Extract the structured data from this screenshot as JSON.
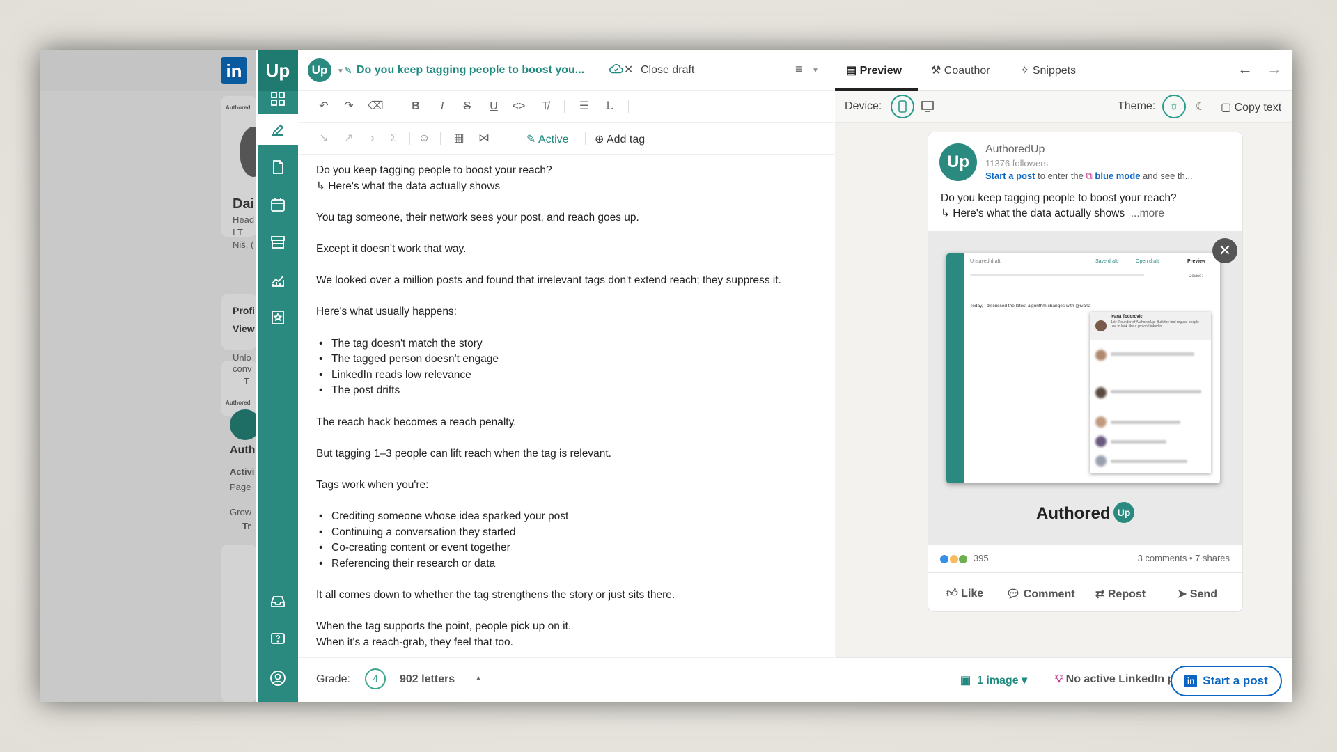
{
  "linkedin_bg": {
    "logo": "in",
    "authored_small": "Authored",
    "name_fragment": "Dai",
    "headline_fragment": "Head",
    "line2": "I T",
    "location_fragment": "Niš, (",
    "profile_fragment": "Profi",
    "view_fragment": "View",
    "unlock_fragment": "Unlo",
    "conv_fragment": "conv",
    "t_fragment": "T",
    "authored_small2": "Authored",
    "auth_fragment": "Auth",
    "activity_fragment": "Activi",
    "page_fragment": "Page",
    "grow_fragment": "Grow",
    "tr_fragment": "Tr"
  },
  "rail": {
    "logo": "Up",
    "items": [
      "dashboard-icon",
      "editor-icon",
      "drafts-icon",
      "calendar-icon",
      "archive-icon",
      "analytics-icon",
      "bookmark-icon",
      "inbox-icon",
      "help-icon",
      "profile-icon"
    ]
  },
  "editor": {
    "badge": "Up",
    "draft_title": "Do you keep tagging people to boost you...",
    "close_draft": "Close draft",
    "active_label": "Active",
    "add_tag_label": "Add tag",
    "body": [
      "Do you keep tagging people to boost your reach?",
      "↳ Here's what the data actually shows",
      "",
      "You tag someone, their network sees your post, and reach goes up.",
      "",
      "Except it doesn't work that way.",
      "",
      "We looked over a million posts and found that irrelevant tags don't extend reach; they suppress it.",
      "",
      "Here's what usually happens:",
      "",
      "•The tag doesn't match the story",
      "•The tagged person doesn't engage",
      "•LinkedIn reads low relevance",
      "•The post drifts",
      "",
      "The reach hack becomes a reach penalty.",
      "",
      "But tagging 1–3 people can lift reach when the tag is relevant.",
      "",
      "Tags work when you're:",
      "",
      "•Crediting someone whose idea sparked your post",
      "•Continuing a conversation they started",
      "•Co-creating content or event together",
      "•Referencing their research or data",
      "",
      "It all comes down to whether the tag strengthens the story or just sits there.",
      "",
      "When the tag supports the point, people pick up on it.",
      "When it's a reach-grab, they feel that too."
    ],
    "grade_label": "Grade:",
    "grade_value": "4",
    "letters": "902 letters"
  },
  "preview": {
    "tabs": [
      "Preview",
      "Coauthor",
      "Snippets"
    ],
    "device_label": "Device:",
    "theme_label": "Theme:",
    "copy_text": "Copy text",
    "post": {
      "author": "AuthoredUp",
      "followers": "11376 followers",
      "cta_link": "Start a post",
      "cta_mid": " to enter the ",
      "cta_mode": "blue mode",
      "cta_end": " and see th...",
      "line1": "Do you keep tagging people to boost your reach?",
      "line2": "↳ Here's what the data actually shows",
      "more": "...more",
      "image_brand": "Authored",
      "image_brand_up": "Up",
      "mini_unsaved": "Unsaved draft",
      "mini_save": "Save draft",
      "mini_open": "Open draft",
      "mini_preview": "Preview",
      "mini_device": "Device:",
      "mini_text": "Today, I discussed the latest algorithm changes with @ivana",
      "mini_person": "Ivana Todorovic",
      "mini_person_sub": "1st • Founder of AuthoredUp. Built the tool regular people use to look like a pro on LinkedIn",
      "reaction_count": "395",
      "comments_shares": "3 comments • 7 shares",
      "actions": [
        "Like",
        "Comment",
        "Repost",
        "Send"
      ]
    },
    "footer": {
      "image_count": "1 image",
      "no_active": "No active LinkedIn post",
      "start_post": "Start a post"
    }
  },
  "colors": {
    "brand_green": "#2b8a80",
    "accent_teal": "#1f8a7f",
    "linkedin_blue": "#0a66c2"
  }
}
